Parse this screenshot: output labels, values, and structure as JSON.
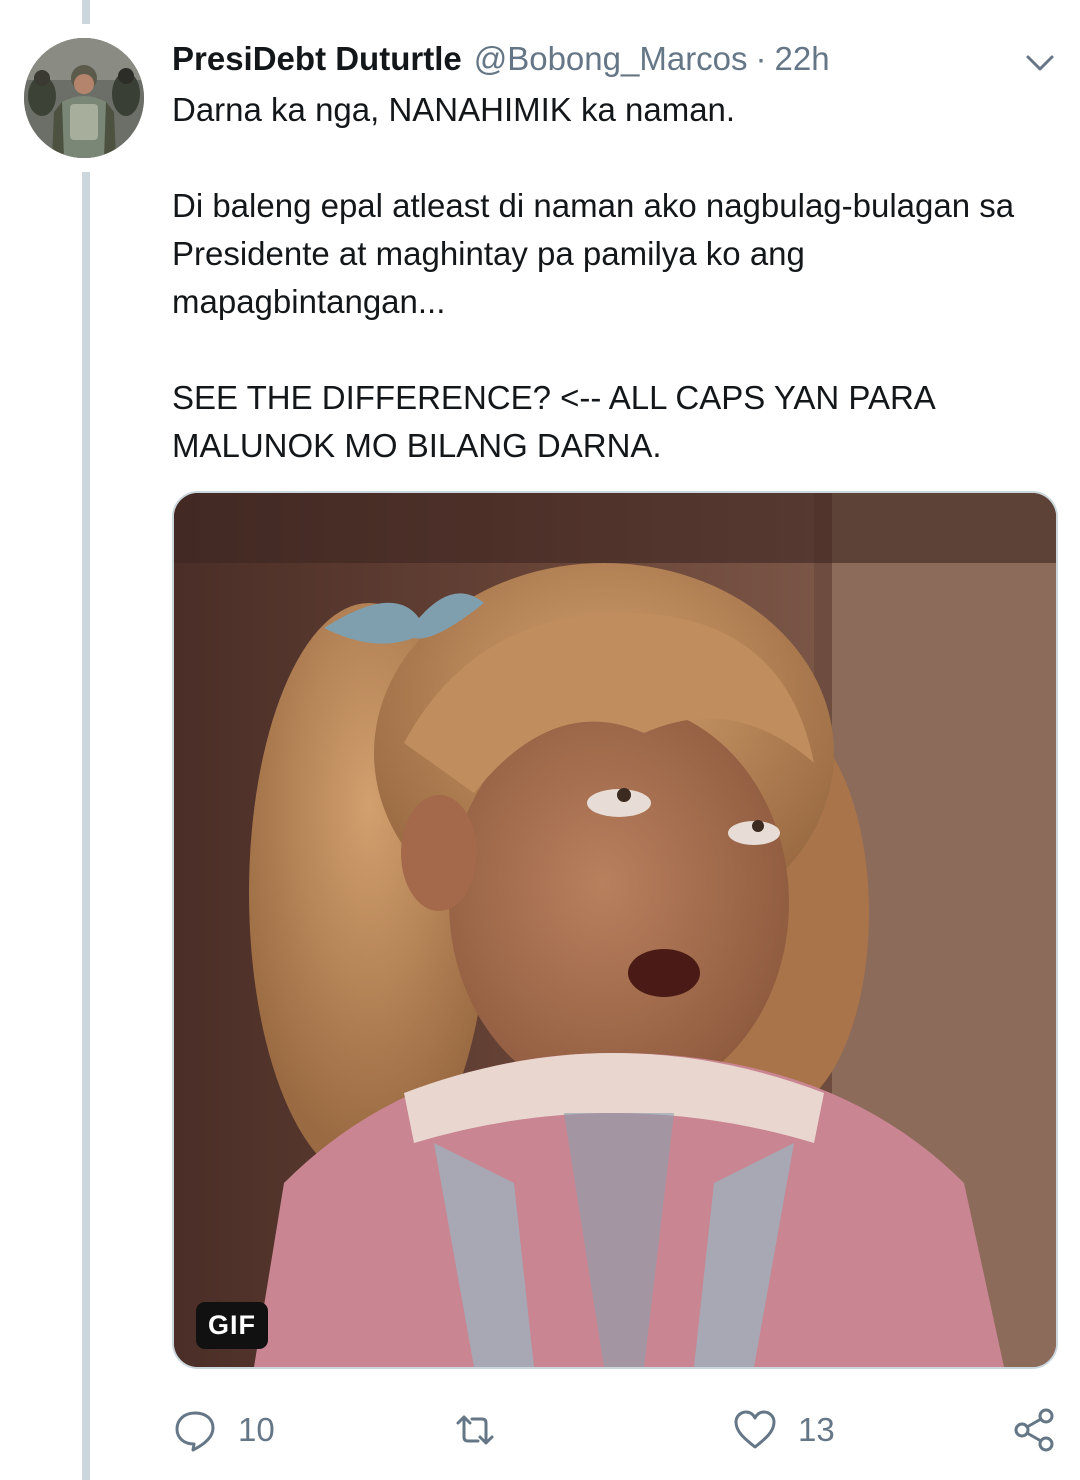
{
  "tweet": {
    "display_name": "PresiDebt Duturtle",
    "handle": "@Bobong_Marcos",
    "separator": "·",
    "time": "22h",
    "paragraphs": [
      "Darna ka nga, NANAHIMIK ka naman.",
      "Di baleng epal atleast di naman ako nagbulag-bulagan sa Presidente at maghintay pa pamilya ko ang mapagbintangan...",
      "SEE THE DIFFERENCE? <-- ALL CAPS YAN PARA MALUNOK MO BILANG DARNA."
    ],
    "media": {
      "badge": "GIF"
    }
  },
  "actions": {
    "reply_count": "10",
    "retweet_count": "",
    "like_count": "13"
  },
  "icons": {
    "menu": "chevron-down-icon",
    "reply": "reply-icon",
    "retweet": "retweet-icon",
    "like": "heart-icon",
    "share": "share-icon"
  },
  "colors": {
    "text": "#14171a",
    "secondary": "#657786",
    "thread_line": "#ccd6dd"
  }
}
